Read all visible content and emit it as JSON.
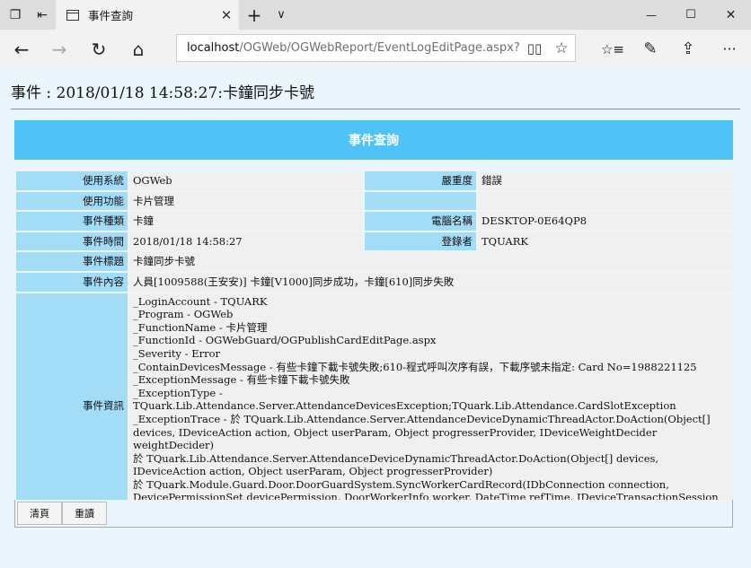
{
  "browser": {
    "tab_title": "事件查詢",
    "tab_close": "✕",
    "new_tab": "+",
    "tab_list": "∨",
    "minimize": "—",
    "maximize": "☐",
    "close": "✕",
    "url_host": "localhost",
    "url_path": "/OGWeb/OGWebReport/EventLogEditPage.aspx?PK=",
    "back": "←",
    "forward": "→",
    "refresh": "↻",
    "home": "⌂",
    "reading_view": "📖",
    "favorite": "☆",
    "favorites": "☆≡",
    "notes": "✎",
    "share": "⇪",
    "more": "···"
  },
  "page": {
    "title": "事件 : 2018/01/18 14:58:27:卡鐘同步卡號",
    "panel_header": "事件查詢"
  },
  "fields": {
    "system_label": "使用系統",
    "system_value": "OGWeb",
    "severity_label": "嚴重度",
    "severity_value": "錯誤",
    "function_label": "使用功能",
    "function_value": "卡片管理",
    "event_type_label": "事件種類",
    "event_type_value": "卡鐘",
    "computer_label": "電腦名稱",
    "computer_value": "DESKTOP-0E64QP8",
    "event_time_label": "事件時間",
    "event_time_value": "2018/01/18 14:58:27",
    "user_label": "登錄者",
    "user_value": "TQUARK",
    "event_title_label": "事件標題",
    "event_title_value": "卡鐘同步卡號",
    "event_content_label": "事件內容",
    "event_content_value": "人員[1009588(王安安)] 卡鐘[V1000]同步成功，卡鐘[610]同步失敗",
    "event_info_label": "事件資訊",
    "event_info_lines": [
      "_LoginAccount - TQUARK",
      "_Program - OGWeb",
      "_FunctionName - 卡片管理",
      "_FunctionId - OGWebGuard/OGPublishCardEditPage.aspx",
      "_Severity - Error",
      "_ContainDevicesMessage - 有些卡鐘下載卡號失敗;610-程式呼叫次序有誤，下載序號未指定: Card No=1988221125",
      "_ExceptionMessage - 有些卡鐘下載卡號失敗",
      "_ExceptionType - TQuark.Lib.Attendance.Server.AttendanceDevicesException;TQuark.Lib.Attendance.CardSlotException",
      "_ExceptionTrace - 於 TQuark.Lib.Attendance.Server.AttendanceDeviceDynamicThreadActor.DoAction(Object[] devices, IDeviceAction action, Object userParam, Object progresserProvider, IDeviceWeightDecider weightDecider)",
      "於 TQuark.Lib.Attendance.Server.AttendanceDeviceDynamicThreadActor.DoAction(Object[] devices, IDeviceAction action, Object userParam, Object progresserProvider)",
      "於 TQuark.Module.Guard.Door.DoorGuardSystem.SyncWorkerCardRecord(IDbConnection connection, DevicePermissionSet devicePermission, DoorWorkerInfo worker, DateTime refTime, IDeviceTransactionSession session, Boolean logAction, Boolean byPassMirrorCheck)"
    ]
  },
  "buttons": {
    "clear": "清頁",
    "reset": "重讀"
  }
}
